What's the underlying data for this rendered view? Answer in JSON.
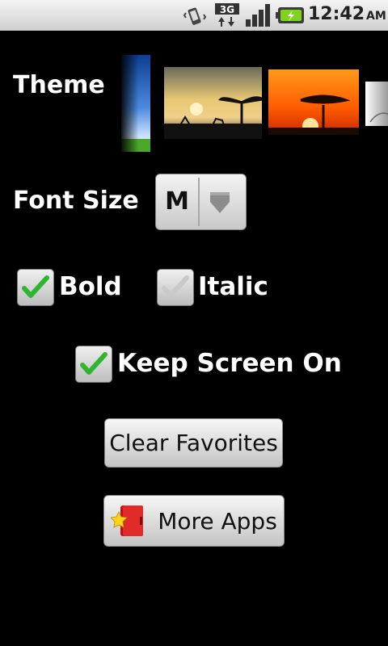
{
  "status_bar": {
    "time": "12:42",
    "ampm": "AM",
    "network": "3G",
    "icons": [
      "vibrate-icon",
      "3g-data-icon",
      "signal-icon",
      "battery-charging-icon"
    ]
  },
  "theme": {
    "label": "Theme"
  },
  "font_size": {
    "label": "Font Size",
    "value": "M"
  },
  "options": {
    "bold": {
      "label": "Bold",
      "checked": true
    },
    "italic": {
      "label": "Italic",
      "checked": false
    },
    "keep_screen_on": {
      "label": "Keep Screen On",
      "checked": true
    }
  },
  "buttons": {
    "clear_favorites": "Clear Favorites",
    "more_apps": "More Apps"
  },
  "colors": {
    "background": "#000000",
    "check_green": "#2fb52f"
  }
}
